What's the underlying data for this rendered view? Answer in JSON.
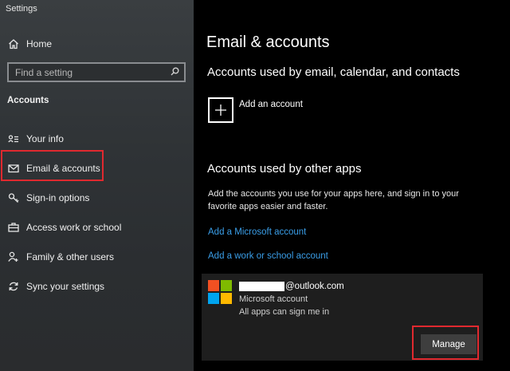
{
  "window": {
    "title": "Settings"
  },
  "sidebar": {
    "home_label": "Home",
    "search": {
      "placeholder": "Find a setting",
      "value": ""
    },
    "section_label": "Accounts",
    "items": [
      {
        "label": "Your info",
        "icon": "person-list-icon"
      },
      {
        "label": "Email & accounts",
        "icon": "mail-icon",
        "selected": true
      },
      {
        "label": "Sign-in options",
        "icon": "key-icon"
      },
      {
        "label": "Access work or school",
        "icon": "briefcase-icon"
      },
      {
        "label": "Family & other users",
        "icon": "person-add-icon"
      },
      {
        "label": "Sync your settings",
        "icon": "sync-icon"
      }
    ]
  },
  "main": {
    "title": "Email & accounts",
    "section1": {
      "heading": "Accounts used by email, calendar, and contacts",
      "add_account_label": "Add an account"
    },
    "section2": {
      "heading": "Accounts used by other apps",
      "description": "Add the accounts you use for your apps here, and sign in to your favorite apps easier and faster.",
      "link_microsoft": "Add a Microsoft account",
      "link_work": "Add a work or school account"
    },
    "account": {
      "email_suffix": "@outlook.com",
      "type": "Microsoft account",
      "status": "All apps can sign me in",
      "manage_label": "Manage"
    }
  },
  "colors": {
    "accent_link": "#3a9ee8",
    "highlight": "#e0292f",
    "ms_red": "#f25022",
    "ms_green": "#7fba00",
    "ms_blue": "#00a4ef",
    "ms_yellow": "#ffb900"
  }
}
